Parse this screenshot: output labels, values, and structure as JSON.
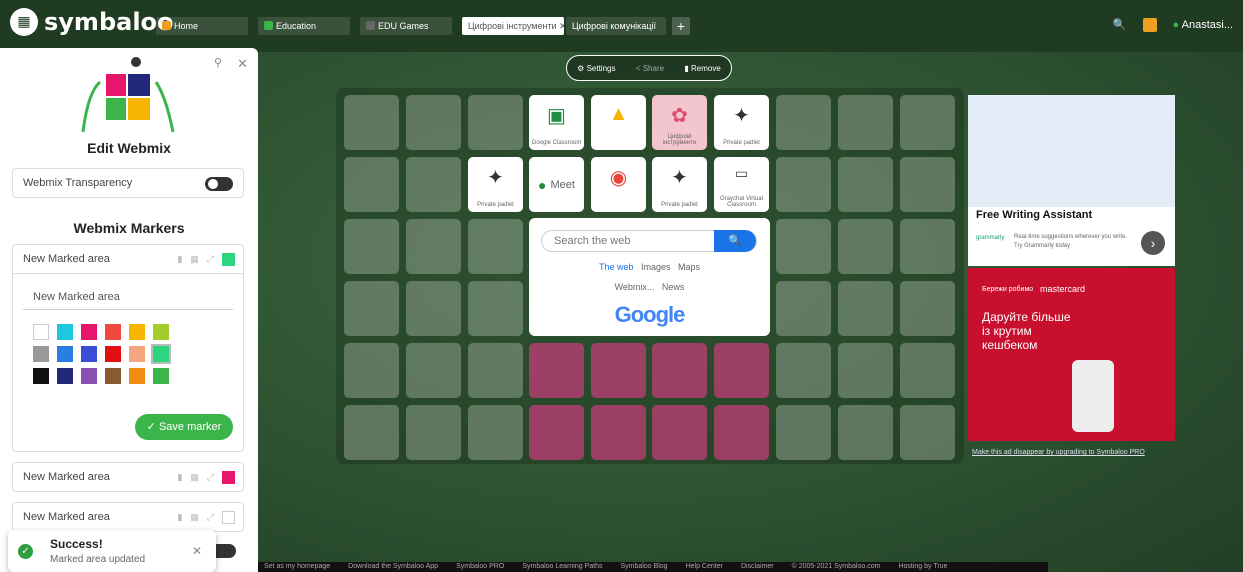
{
  "app": {
    "logo": "symbaloo",
    "user": "Anastasi..."
  },
  "tabs": [
    {
      "label": "Home",
      "color": "#f0a020"
    },
    {
      "label": "Education",
      "color": "#3bb44a"
    },
    {
      "label": "EDU Games",
      "color": "#666"
    },
    {
      "label": "Цифрові інструменти",
      "color": "#fff",
      "active": true
    },
    {
      "label": "Цифрові комунікації",
      "color": "#fff"
    }
  ],
  "toolbar": {
    "settings": "Settings",
    "share": "Share",
    "remove": "Remove"
  },
  "panel": {
    "title": "Edit Webmix",
    "transparency_label": "Webmix Transparency",
    "markers_title": "Webmix Markers",
    "markers": [
      {
        "label": "New Marked area",
        "color": "#2ed580"
      },
      {
        "label": "New Marked area",
        "color": "#e8156d"
      },
      {
        "label": "New Marked area",
        "color": "#ffffff"
      }
    ],
    "name_value": "New Marked area",
    "palette": [
      "#ffffff",
      "#1cc8e0",
      "#e8156d",
      "#f0483e",
      "#f6b400",
      "#a4cc2c",
      "#999999",
      "#2a7de1",
      "#3a4cd8",
      "#e01010",
      "#f5a680",
      "#2ed580",
      "#111111",
      "#22287a",
      "#8a4fb0",
      "#8a5a30",
      "#f08c10",
      "#3bb44a"
    ],
    "save_label": "Save marker"
  },
  "toast": {
    "title": "Success!",
    "message": "Marked area updated"
  },
  "tiles": [
    {
      "label": "Google Classroom"
    },
    {
      "label": ""
    },
    {
      "label": "Цифрові інструменти"
    },
    {
      "label": "Private padlet"
    },
    {
      "label": "Private padlet"
    },
    {
      "label": "Meet"
    },
    {
      "label": ""
    },
    {
      "label": "Private padlet"
    },
    {
      "label": "Graychat Virtual Classroom"
    }
  ],
  "search": {
    "placeholder": "Search the web",
    "options": [
      "The web",
      "Images",
      "Maps",
      "Webmix...",
      "News"
    ],
    "logo": "Google"
  },
  "ads": {
    "grammarly": {
      "headline": "Free Writing Assistant",
      "brand": "grammarly",
      "desc": "Real-time suggestions wherever you write. Try Grammarly today"
    },
    "mastercard": {
      "brand1": "Бережи робимо",
      "brand2": "mastercard",
      "text": "Даруйте більше із крутим кешбеком"
    },
    "remove_link": "Make this ad disappear by upgrading to Symbaloo PRO"
  },
  "footer": [
    "Set as my homepage",
    "Download the Symbaloo App",
    "Symbaloo PRO",
    "Symbaloo Learning Paths",
    "Symbaloo Blog",
    "Help Center",
    "Disclaimer",
    "© 2005-2021 Symbaloo.com",
    "Hosting by True"
  ]
}
